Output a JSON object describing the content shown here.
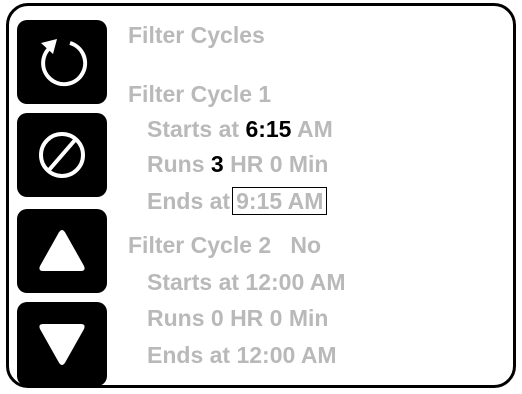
{
  "screen": {
    "title": "Filter Cycles"
  },
  "buttons": {
    "back_icon": "circular-arrow-back-icon",
    "cancel_icon": "cancel-circle-slash-icon",
    "up_icon": "triangle-up-icon",
    "down_icon": "triangle-down-icon"
  },
  "filter_cycle_1": {
    "heading": "Filter Cycle 1",
    "starts_label": "Starts at",
    "starts_time": "6:15",
    "starts_ampm": "AM",
    "runs_label": "Runs",
    "runs_hours": "3",
    "runs_rest": "HR 0 Min",
    "ends_label": "Ends at",
    "ends_value": "9:15 AM"
  },
  "filter_cycle_2": {
    "heading": "Filter Cycle 2",
    "enabled": "No",
    "starts": "Starts at 12:00 AM",
    "runs": "Runs 0 HR 0 Min",
    "ends": "Ends at 12:00 AM"
  },
  "colors": {
    "inactive_text": "#b9b9b9",
    "active_text": "#000000",
    "button_bg": "#000000",
    "icon": "#ffffff"
  }
}
